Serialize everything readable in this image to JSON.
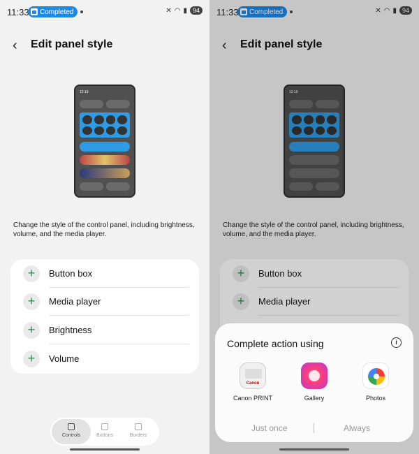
{
  "status": {
    "time": "11:33",
    "pill": "Completed",
    "battery": "94"
  },
  "header": {
    "back": "‹",
    "title": "Edit panel style"
  },
  "preview": {
    "clock": "12:19"
  },
  "description": "Change the style of the control panel, including brightness, volume, and the media player.",
  "options": [
    "Button box",
    "Media player",
    "Brightness",
    "Volume"
  ],
  "plus_symbol": "+",
  "tabs": [
    "Controls",
    "Buttons",
    "Borders"
  ],
  "dialog": {
    "title": "Complete action using",
    "info": "i",
    "apps": [
      "Canon PRINT",
      "Gallery",
      "Photos"
    ],
    "just_once": "Just once",
    "always": "Always"
  }
}
